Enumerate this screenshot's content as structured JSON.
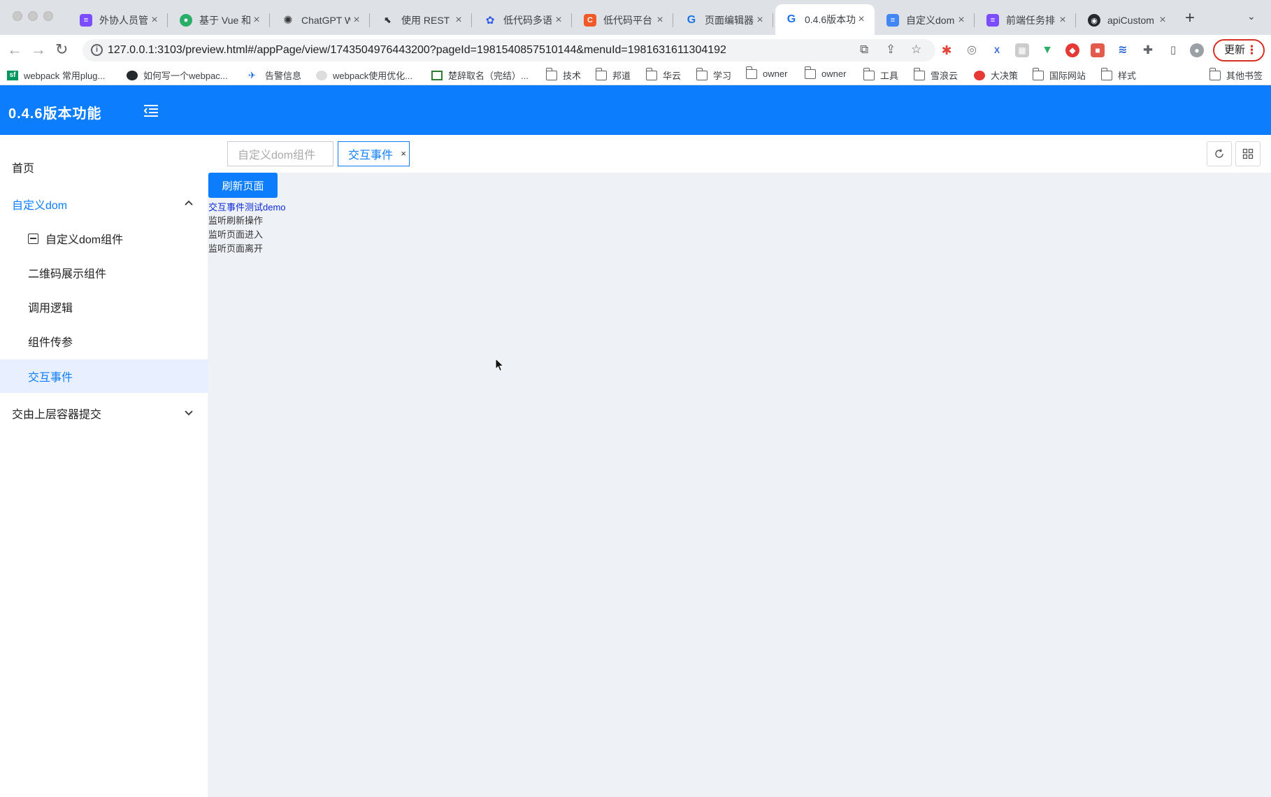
{
  "browser": {
    "tabs": [
      {
        "title": "外协人员管",
        "favicon_color": "#7c4dff"
      },
      {
        "title": "基于 Vue 和",
        "favicon_color": "#2aae67"
      },
      {
        "title": "ChatGPT W",
        "favicon_color": "#333333"
      },
      {
        "title": "使用 REST",
        "favicon_color": "#333333"
      },
      {
        "title": "低代码多语",
        "favicon_color": "#2f5de8"
      },
      {
        "title": "低代码平台",
        "favicon_color": "#f05a28"
      },
      {
        "title": "页面编辑器",
        "favicon_color": "#1a73e8"
      },
      {
        "title": "0.4.6版本功",
        "favicon_color": "#1a73e8",
        "active": true
      },
      {
        "title": "自定义dom",
        "favicon_color": "#4285f4"
      },
      {
        "title": "前端任务排",
        "favicon_color": "#7c4dff"
      },
      {
        "title": "apiCustom",
        "favicon_color": "#24292e"
      }
    ],
    "url": "127.0.0.1:3103/preview.html#/appPage/view/1743504976443200?pageId=1981540857510144&menuId=1981631611304192",
    "update_label": "更新",
    "bookmarks": [
      {
        "label": "webpack 常用plug...",
        "icon": "sf-icon"
      },
      {
        "label": "如何写一个webpac...",
        "icon": "github-icon"
      },
      {
        "label": "告警信息",
        "icon": "plane-icon"
      },
      {
        "label": "webpack使用优化...",
        "icon": "egg-icon"
      },
      {
        "label": "楚辞取名（完结）...",
        "icon": "book-icon"
      },
      {
        "label": "技术",
        "icon": "folder-icon"
      },
      {
        "label": "邦道",
        "icon": "folder-icon"
      },
      {
        "label": "华云",
        "icon": "folder-icon"
      },
      {
        "label": "学习",
        "icon": "folder-icon"
      },
      {
        "label": "owner",
        "icon": "folder-icon"
      },
      {
        "label": "owner",
        "icon": "folder-icon"
      },
      {
        "label": "工具",
        "icon": "folder-icon"
      },
      {
        "label": "雪浪云",
        "icon": "folder-icon"
      },
      {
        "label": "大决策",
        "icon": "decision-icon"
      },
      {
        "label": "国际网站",
        "icon": "folder-icon"
      },
      {
        "label": "样式",
        "icon": "folder-icon"
      }
    ],
    "other_bookmarks": "其他书签"
  },
  "app": {
    "title": "0.4.6版本功能",
    "accent_color": "#0b7dfd",
    "menu": {
      "home": "首页",
      "group_custom_dom": "自定义dom",
      "custom_dom_component": "自定义dom组件",
      "qrcode_component": "二维码展示组件",
      "call_logic": "调用逻辑",
      "component_params": "组件传参",
      "interaction_events": "交互事件",
      "group_submit": "交由上层容器提交"
    },
    "page_tabs": [
      {
        "label": "自定义dom组件"
      },
      {
        "label": "交互事件",
        "close": "×"
      }
    ],
    "main": {
      "refresh_button": "刷新页面",
      "demo_title": "交互事件测试demo",
      "logs": [
        "监听刷新操作",
        "监听页面进入",
        "监听页面离开"
      ]
    }
  }
}
